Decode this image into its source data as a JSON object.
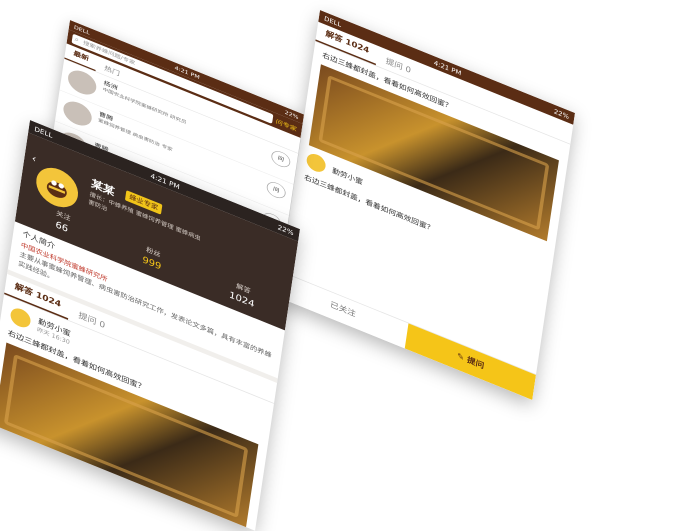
{
  "status": {
    "carrier": "DELL",
    "time": "4:21 PM",
    "battery": "22%"
  },
  "left": {
    "back_icon": "chevron-left-icon",
    "name": "某某",
    "badge": "蜂业专家",
    "desc": "擅长：中蜂养殖 蜜蜂饲养管理 蜜蜂病虫害防治",
    "stats": [
      {
        "label": "关注",
        "value": "66"
      },
      {
        "label": "粉丝",
        "value": "999"
      },
      {
        "label": "解答",
        "value": "1024"
      }
    ],
    "intro_label": "个人简介",
    "intro_highlight": "中国农业科学院蜜蜂研究所",
    "intro_text": "主要从事蜜蜂饲养管理、病虫害防治研究工作，发表论文多篇，具有丰富的养蜂实践经验。",
    "tabs": [
      "解答 1024",
      "提问 0"
    ],
    "post": {
      "name": "勤劳小蜜",
      "time": "昨天 16:30",
      "text": "右边三蜂都封盖，看着如何高效回蜜？"
    }
  },
  "mid": {
    "search_placeholder": "搜索养蜂问题/专家",
    "ask_label": "问专家",
    "tabs": [
      "最新",
      "热门"
    ],
    "experts": [
      {
        "name": "杨洲",
        "desc": "中国农业科学院蜜蜂研究所 研究员",
        "btn": "问"
      },
      {
        "name": "曹腾",
        "desc": "蜜蜂饲养管理 病虫害防治 专家",
        "btn": "问"
      },
      {
        "name": "曹腾",
        "desc": "蜜蜂育种 中蜂饲养 专家",
        "btn": "问"
      }
    ]
  },
  "right": {
    "tabs": [
      "解答 1024",
      "提问 0"
    ],
    "post_text": "右边三蜂都封盖，看着如何高效回蜜？",
    "post2_name": "勤劳小蜜",
    "post2_text": "右边三蜂都封盖，看着如何高效回蜜？",
    "follow_label": "已关注",
    "ask_label": "提问"
  }
}
